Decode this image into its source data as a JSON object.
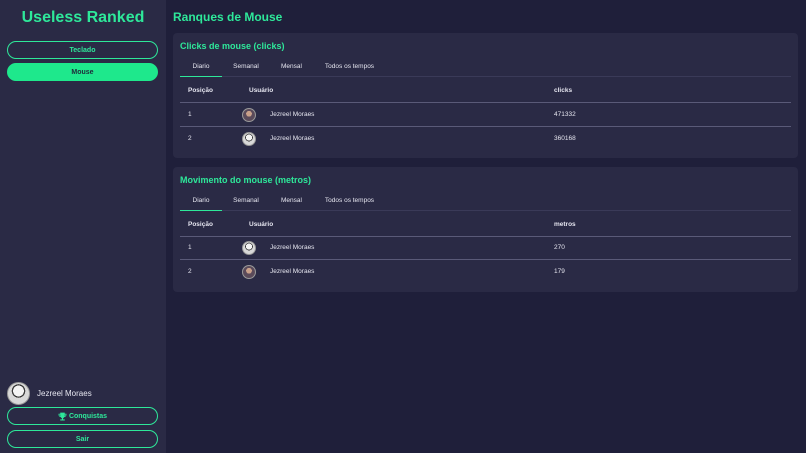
{
  "sidebar": {
    "title": "Useless Ranked",
    "nav": [
      {
        "label": "Teclado"
      },
      {
        "label": "Mouse"
      }
    ],
    "user_name": "Jezreel Moraes",
    "achievements_label": "Conquistas",
    "logout_label": "Sair"
  },
  "main": {
    "title": "Ranques de Mouse",
    "tabs": [
      "Diario",
      "Semanal",
      "Mensal",
      "Todos os tempos"
    ],
    "clicks": {
      "title": "Clicks de mouse (clicks)",
      "headers": [
        "Posição",
        "Usuário",
        "clicks"
      ],
      "rows": [
        {
          "pos": "1",
          "user": "Jezreel Moraes",
          "value": "471332"
        },
        {
          "pos": "2",
          "user": "Jezreel Moraes",
          "value": "360168"
        }
      ]
    },
    "movement": {
      "title": "Movimento do mouse (metros)",
      "headers": [
        "Posição",
        "Usuário",
        "metros"
      ],
      "rows": [
        {
          "pos": "1",
          "user": "Jezreel Moraes",
          "value": "270"
        },
        {
          "pos": "2",
          "user": "Jezreel Moraes",
          "value": "179"
        }
      ]
    }
  },
  "colors": {
    "accent": "#2ee89a",
    "background": "#1f1f3a",
    "panel": "#2a2a45"
  },
  "icons": [
    "trophy-icon",
    "avatar"
  ]
}
